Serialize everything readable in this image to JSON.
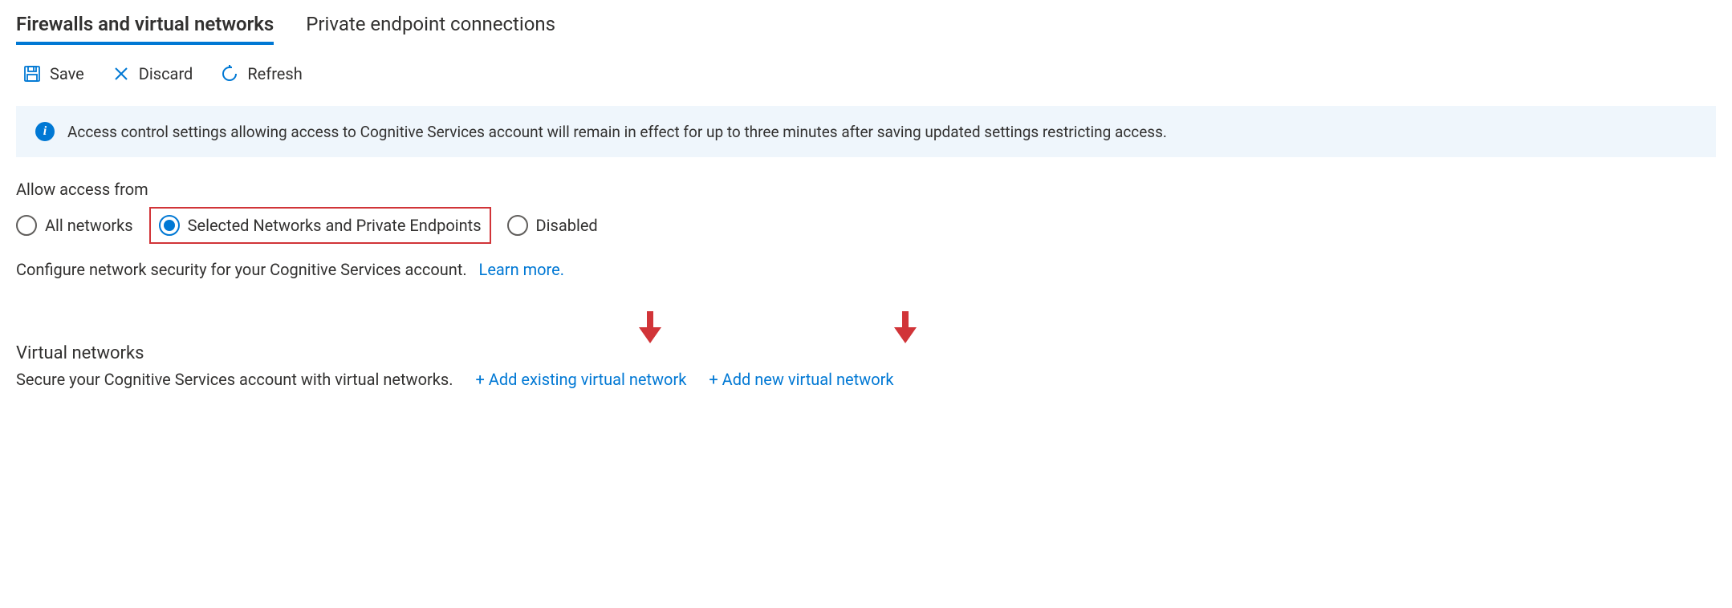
{
  "tabs": {
    "firewalls": "Firewalls and virtual networks",
    "private_endpoints": "Private endpoint connections"
  },
  "toolbar": {
    "save_label": "Save",
    "discard_label": "Discard",
    "refresh_label": "Refresh"
  },
  "info_banner": {
    "text": "Access control settings allowing access to Cognitive Services account will remain in effect for up to three minutes after saving updated settings restricting access."
  },
  "access": {
    "label": "Allow access from",
    "options": {
      "all": "All networks",
      "selected": "Selected Networks and Private Endpoints",
      "disabled": "Disabled"
    },
    "description": "Configure network security for your Cognitive Services account.",
    "learn_more": "Learn more."
  },
  "vnet": {
    "title": "Virtual networks",
    "description": "Secure your Cognitive Services account with virtual networks.",
    "add_existing": "+ Add existing virtual network",
    "add_new": "+ Add new virtual network"
  }
}
